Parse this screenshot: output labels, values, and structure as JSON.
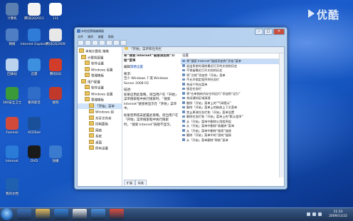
{
  "desktop_icons": [
    {
      "label": "计算机",
      "icon": "computer-icon",
      "color": "#5a7fb0"
    },
    {
      "label": "腾讯QQ2011",
      "icon": "qq-icon",
      "color": "#f2f2f2"
    },
    {
      "label": "111",
      "icon": "document-icon",
      "color": "#ffffff"
    },
    {
      "label": "网络",
      "icon": "network-icon",
      "color": "#4f7ec4"
    },
    {
      "label": "Internet Explorer",
      "icon": "ie-icon",
      "color": "#2f7bd8"
    },
    {
      "label": "腾讯QQ2009",
      "icon": "qq-icon",
      "color": "#e8e8e8"
    },
    {
      "label": "回收站",
      "icon": "recycle-bin-icon",
      "color": "#bcd3ef"
    },
    {
      "label": "迅雷",
      "icon": "thunder-icon",
      "color": "#3d8fe0"
    },
    {
      "label": "腾讯QQ",
      "icon": "qq-icon",
      "color": "#d23c2a"
    },
    {
      "label": "360安全卫士",
      "icon": "shield-icon",
      "color": "#3a9a3a"
    },
    {
      "label": "暴风影音",
      "icon": "media-icon",
      "color": "#2f6dc8"
    },
    {
      "label": "搜狗",
      "icon": "sogou-icon",
      "color": "#c0392b"
    },
    {
      "label": "Foxmail",
      "icon": "mail-icon",
      "color": "#d24a3a"
    },
    {
      "label": "ACDSee",
      "icon": "image-icon",
      "color": "#1a4f9a"
    },
    {
      "label": "Internet",
      "icon": "ie-icon",
      "color": "#2a7bd8"
    },
    {
      "label": "DVD",
      "icon": "dvd-icon",
      "color": "#1a1a1a"
    },
    {
      "label": "快播",
      "icon": "player-icon",
      "color": "#3a7bd0"
    },
    {
      "label": "我的文档",
      "icon": "folder-icon",
      "color": "#2060b0"
    }
  ],
  "watermark": "优酷",
  "window": {
    "title": "本地组策略编辑器",
    "caption": {
      "minimize": "–",
      "maximize": "□",
      "close": "✕"
    },
    "menu": [
      "文件",
      "操作",
      "查看",
      "帮助"
    ],
    "tree": [
      {
        "label": "本地计算机 策略",
        "selected": false
      },
      {
        "label": "计算机配置",
        "selected": false
      },
      {
        "label": "软件设置",
        "selected": false
      },
      {
        "label": "Windows 设置",
        "selected": false
      },
      {
        "label": "管理模板",
        "selected": false
      },
      {
        "label": "用户配置",
        "selected": false
      },
      {
        "label": "软件设置",
        "selected": false
      },
      {
        "label": "Windows 设置",
        "selected": false
      },
      {
        "label": "管理模板",
        "selected": false
      },
      {
        "label": "「开始」菜单",
        "selected": true
      },
      {
        "label": "Windows 组",
        "selected": false
      },
      {
        "label": "共享文件夹",
        "selected": false
      },
      {
        "label": "控制面板",
        "selected": false
      },
      {
        "label": "网络",
        "selected": false
      },
      {
        "label": "系统",
        "selected": false
      },
      {
        "label": "桌面",
        "selected": false
      },
      {
        "label": "所有设置",
        "selected": false
      }
    ],
    "right_header": "「开始」菜单和任务栏",
    "description": {
      "heading": "将“搜索 Internet”链接添加到“开始”菜单",
      "edit_prefix": "编辑",
      "edit_link": "策略设置",
      "requirements_label": "要求:",
      "requirements": "至少 Windows 7 或 Windows Server 2008 R2",
      "desc_label": "描述:",
      "desc_text": "如果启用此策略，则当用户在「开始」菜单搜索框中执行搜索时，“搜索 Internet”链接将显示在「开始」菜单中。",
      "desc_text2": "如果禁用或未配置此策略，则当用户在「开始」菜单搜索框中执行搜索时，“搜索 Internet”链接不显示。"
    },
    "list_header": "设置",
    "policies": [
      {
        "label": "将“搜索 Internet”链接添加到“开始”菜单",
        "selected": true
      },
      {
        "label": "退出系统时清除最近打开的文档的历史",
        "selected": false
      },
      {
        "label": "不保留最近打开文档的历史",
        "selected": false
      },
      {
        "label": "将“注销”添加到「开始」菜单",
        "selected": false
      },
      {
        "label": "不允许锁定程序到任务栏",
        "selected": false
      },
      {
        "label": "关闭个性化菜单",
        "selected": false
      },
      {
        "label": "锁定任务栏",
        "selected": false
      },
      {
        "label": "将“在单独的内存空间运行”添加到“运行”",
        "selected": false
      },
      {
        "label": "关闭通知区域清理",
        "selected": false
      },
      {
        "label": "删除「开始」菜单上的“气球提示”",
        "selected": false
      },
      {
        "label": "删除「开始」菜单上的拖放上下文菜单",
        "selected": false
      },
      {
        "label": "禁止更改任务栏和「开始」菜单设置",
        "selected": false
      },
      {
        "label": "删除任务栏和「开始」菜单上的“默认程序”",
        "selected": false
      },
      {
        "label": "从「开始」菜单中删除公用程序组",
        "selected": false
      },
      {
        "label": "从「开始」菜单中删除“收藏夹”菜单",
        "selected": false
      },
      {
        "label": "从「开始」菜单中删除“搜索”链接",
        "selected": false
      },
      {
        "label": "删除「开始」菜单中的“游戏”链接",
        "selected": false
      },
      {
        "label": "从「开始」菜单删除“帮助”菜单",
        "selected": false
      }
    ],
    "tabs": [
      "扩展",
      "标准"
    ]
  },
  "taskbar": {
    "apps": [
      {
        "icon": "media-player-icon",
        "color": "#3a6fb8"
      },
      {
        "icon": "folder-icon",
        "color": "#e0b85a"
      },
      {
        "icon": "ie-icon",
        "color": "#3580d8"
      },
      {
        "icon": "qq-icon",
        "color": "#e8e8e8"
      },
      {
        "icon": "thunder-icon",
        "color": "#4a8fe0"
      },
      {
        "icon": "shield-icon",
        "color": "#d94a3a"
      }
    ],
    "time": "11:33",
    "date": "2009/11/22"
  }
}
